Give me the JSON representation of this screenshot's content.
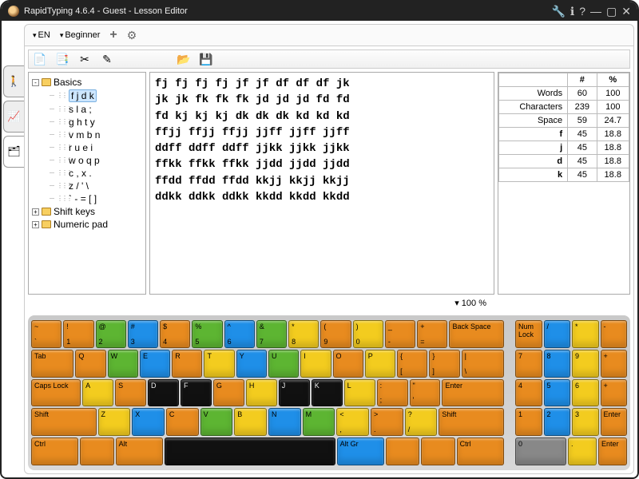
{
  "title": "RapidTyping 4.6.4 - Guest - Lesson Editor",
  "toolbar": {
    "lang": "EN",
    "level": "Beginner"
  },
  "zoom": "100 %",
  "tree": {
    "root": "Basics",
    "items": [
      "f j d k",
      "s l a ;",
      "g h t y",
      "v m b n",
      "r u e i",
      "w o q p",
      "c , x .",
      "z / ' \\",
      "` - = [ ]"
    ],
    "folders": [
      "Shift keys",
      "Numeric pad"
    ]
  },
  "lessonText": "fj fj fj fj jf jf df df df jk\njk jk fk fk fk jd jd jd fd fd\nfd kj kj kj dk dk dk kd kd kd\nffjj ffjj ffjj jjff jjff jjff\nddff ddff ddff jjkk jjkk jjkk\nffkk ffkk ffkk jjdd jjdd jjdd\nffdd ffdd ffdd kkjj kkjj kkjj\nddkk ddkk ddkk kkdd kkdd kkdd",
  "stats": {
    "headers": [
      "",
      "#",
      "%"
    ],
    "rows": [
      [
        "Words",
        "60",
        "100"
      ],
      [
        "Characters",
        "239",
        "100"
      ],
      [
        "Space",
        "59",
        "24.7"
      ],
      [
        "f",
        "45",
        "18.8"
      ],
      [
        "j",
        "45",
        "18.8"
      ],
      [
        "d",
        "45",
        "18.8"
      ],
      [
        "k",
        "45",
        "18.8"
      ]
    ]
  },
  "kb": {
    "r1": [
      {
        "u": "~",
        "l": "`",
        "c": "or"
      },
      {
        "u": "!",
        "l": "1",
        "c": "or"
      },
      {
        "u": "@",
        "l": "2",
        "c": "gr"
      },
      {
        "u": "#",
        "l": "3",
        "c": "bl"
      },
      {
        "u": "$",
        "l": "4",
        "c": "or"
      },
      {
        "u": "%",
        "l": "5",
        "c": "gr"
      },
      {
        "u": "^",
        "l": "6",
        "c": "bl"
      },
      {
        "u": "&",
        "l": "7",
        "c": "gr"
      },
      {
        "u": "*",
        "l": "8",
        "c": "ye"
      },
      {
        "u": "(",
        "l": "9",
        "c": "or"
      },
      {
        "u": ")",
        "l": "0",
        "c": "ye"
      },
      {
        "u": "_",
        "l": "-",
        "c": "or"
      },
      {
        "u": "+",
        "l": "=",
        "c": "or"
      },
      {
        "t": "Back Space",
        "c": "or",
        "w": "wide2"
      }
    ],
    "r2": [
      {
        "t": "Tab",
        "c": "or",
        "w": "wide15"
      },
      {
        "u": "Q",
        "c": "or"
      },
      {
        "u": "W",
        "c": "gr"
      },
      {
        "u": "E",
        "c": "bl"
      },
      {
        "u": "R",
        "c": "or"
      },
      {
        "u": "T",
        "c": "ye"
      },
      {
        "u": "Y",
        "c": "bl"
      },
      {
        "u": "U",
        "c": "gr"
      },
      {
        "u": "I",
        "c": "ye"
      },
      {
        "u": "O",
        "c": "or"
      },
      {
        "u": "P",
        "c": "ye"
      },
      {
        "u": "{",
        "l": "[",
        "c": "or"
      },
      {
        "u": "}",
        "l": "]",
        "c": "or"
      },
      {
        "u": "|",
        "l": "\\",
        "c": "or",
        "w": "wide15"
      }
    ],
    "r3": [
      {
        "t": "Caps Lock",
        "c": "or",
        "w": "wide175"
      },
      {
        "u": "A",
        "c": "ye"
      },
      {
        "u": "S",
        "c": "or"
      },
      {
        "u": "D",
        "c": "bk"
      },
      {
        "u": "F",
        "c": "bk"
      },
      {
        "u": "G",
        "c": "or"
      },
      {
        "u": "H",
        "c": "ye"
      },
      {
        "u": "J",
        "c": "bk"
      },
      {
        "u": "K",
        "c": "bk"
      },
      {
        "u": "L",
        "c": "ye"
      },
      {
        "u": ":",
        "l": ";",
        "c": "or"
      },
      {
        "u": "\"",
        "l": "'",
        "c": "or"
      },
      {
        "t": "Enter",
        "c": "or",
        "w": "wide225"
      }
    ],
    "r4": [
      {
        "t": "Shift",
        "c": "or",
        "w": "wide225"
      },
      {
        "u": "Z",
        "c": "ye"
      },
      {
        "u": "X",
        "c": "bl"
      },
      {
        "u": "C",
        "c": "or"
      },
      {
        "u": "V",
        "c": "gr"
      },
      {
        "u": "B",
        "c": "ye"
      },
      {
        "u": "N",
        "c": "bl"
      },
      {
        "u": "M",
        "c": "gr"
      },
      {
        "u": "<",
        "l": ",",
        "c": "ye"
      },
      {
        "u": ">",
        "l": ".",
        "c": "or"
      },
      {
        "u": "?",
        "l": "/",
        "c": "ye"
      },
      {
        "t": "Shift",
        "c": "or",
        "w": "wide225"
      }
    ],
    "r5": [
      {
        "t": "Ctrl",
        "c": "or",
        "w": "wide15"
      },
      {
        "t": "",
        "c": "or"
      },
      {
        "t": "Alt",
        "c": "or",
        "w": "wide15"
      },
      {
        "t": "",
        "c": "bk",
        "w": "wide6"
      },
      {
        "t": "Alt Gr",
        "c": "bl",
        "w": "wide15"
      },
      {
        "t": "",
        "c": "or"
      },
      {
        "t": "",
        "c": "or"
      },
      {
        "t": "Ctrl",
        "c": "or",
        "w": "wide15"
      }
    ],
    "n1": [
      {
        "t": "Num Lock",
        "c": "or"
      },
      {
        "u": "/",
        "c": "bl"
      },
      {
        "u": "*",
        "c": "ye"
      },
      {
        "u": "-",
        "c": "or"
      }
    ],
    "n2": [
      {
        "u": "7",
        "c": "or"
      },
      {
        "u": "8",
        "c": "bl"
      },
      {
        "u": "9",
        "c": "ye"
      },
      {
        "u": "+",
        "c": "or"
      }
    ],
    "n3": [
      {
        "u": "4",
        "c": "or"
      },
      {
        "u": "5",
        "c": "bl"
      },
      {
        "u": "6",
        "c": "ye"
      },
      {
        "u": "+",
        "c": "or"
      }
    ],
    "n4": [
      {
        "u": "1",
        "c": "or"
      },
      {
        "u": "2",
        "c": "bl"
      },
      {
        "u": "3",
        "c": "ye"
      },
      {
        "t": "Enter",
        "c": "or"
      }
    ],
    "n5": [
      {
        "u": "0",
        "c": "gy",
        "w": "wide2"
      },
      {
        "u": ".",
        "c": "ye"
      },
      {
        "t": "Enter",
        "c": "or"
      }
    ]
  }
}
